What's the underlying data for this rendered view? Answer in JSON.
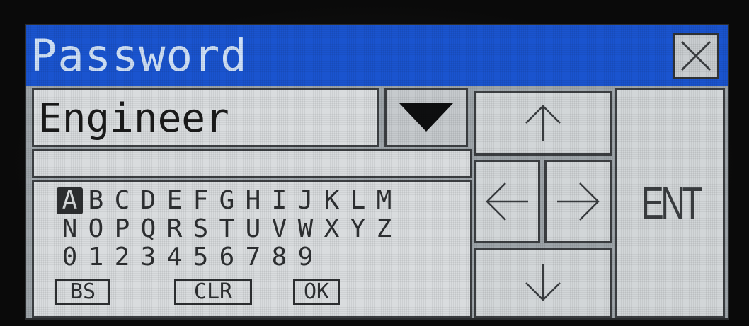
{
  "dialog": {
    "title": "Password",
    "close_icon": "close-x-icon"
  },
  "user": {
    "value": "Engineer",
    "dropdown_icon": "triangle-down-icon"
  },
  "password": {
    "value": ""
  },
  "keyboard": {
    "rows": [
      [
        "A",
        "B",
        "C",
        "D",
        "E",
        "F",
        "G",
        "H",
        "I",
        "J",
        "K",
        "L",
        "M"
      ],
      [
        "N",
        "O",
        "P",
        "Q",
        "R",
        "S",
        "T",
        "U",
        "V",
        "W",
        "X",
        "Y",
        "Z"
      ],
      [
        "0",
        "1",
        "2",
        "3",
        "4",
        "5",
        "6",
        "7",
        "8",
        "9"
      ]
    ],
    "selected": "A",
    "bs_label": "BS",
    "clr_label": "CLR",
    "ok_label": "OK"
  },
  "navigation": {
    "up_icon": "arrow-up-icon",
    "left_icon": "arrow-left-icon",
    "right_icon": "arrow-right-icon",
    "down_icon": "arrow-down-icon",
    "ent_label": "ENT"
  },
  "colors": {
    "titlebar": "#1a54cf",
    "title_text": "#cfe0f6",
    "panel": "#d9dcde",
    "ink": "#2d2f31"
  }
}
